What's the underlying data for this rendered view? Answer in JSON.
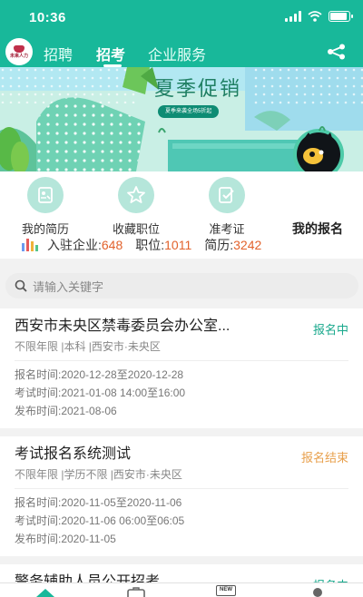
{
  "status_bar": {
    "time": "10:36"
  },
  "nav": {
    "logo_text": "未来人力",
    "tabs": [
      {
        "label": "招聘",
        "active": false
      },
      {
        "label": "招考",
        "active": true
      },
      {
        "label": "企业服务",
        "active": false
      }
    ]
  },
  "banner": {
    "title": "夏季促销",
    "subtitle": "夏季来袭全场5折起"
  },
  "quick": [
    {
      "label": "我的简历",
      "icon": "resume-icon"
    },
    {
      "label": "收藏职位",
      "icon": "star-icon"
    },
    {
      "label": "准考证",
      "icon": "admission-ticket-icon"
    },
    {
      "label": "我的报名",
      "icon": "cat-mascot-icon"
    }
  ],
  "stats": {
    "companies_label": "入驻企业:",
    "companies": "648",
    "positions_label": "职位:",
    "positions": "1011",
    "resumes_label": "简历:",
    "resumes": "3242"
  },
  "search": {
    "placeholder": "请输入关键字"
  },
  "items": [
    {
      "title": "西安市未央区禁毒委员会办公室...",
      "status": "报名中",
      "status_color": "#18a88c",
      "meta": "不限年限 |本科 |西安市·未央区",
      "signup": "报名时间:2020-12-28至2020-12-28",
      "exam": "考试时间:2021-01-08 14:00至16:00",
      "publish": "发布时间:2021-08-06"
    },
    {
      "title": "考试报名系统测试",
      "status": "报名结束",
      "status_color": "#e8a04c",
      "meta": "不限年限 |学历不限 |西安市·未央区",
      "signup": "报名时间:2020-11-05至2020-11-06",
      "exam": "考试时间:2020-11-06 06:00至06:05",
      "publish": "发布时间:2020-11-05"
    },
    {
      "title": "警务辅助人员公开招考",
      "status": "报名中",
      "status_color": "#18a88c"
    }
  ],
  "bottom_nav": {
    "badge_new": "NEW"
  },
  "colors": {
    "primary": "#18b89a",
    "accent_orange": "#e2622c"
  }
}
